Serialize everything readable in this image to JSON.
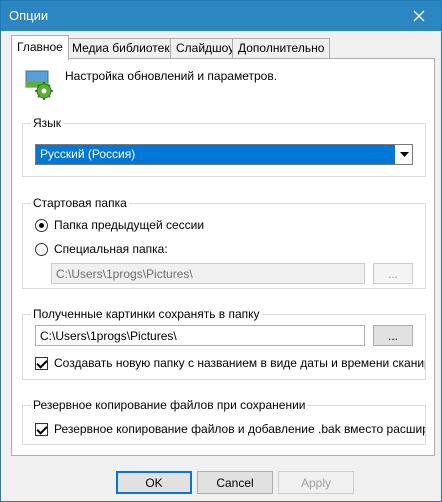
{
  "window": {
    "title": "Опции"
  },
  "tabs": [
    {
      "label": "Главное",
      "active": true
    },
    {
      "label": "Медиа библиотека",
      "active": false
    },
    {
      "label": "Слайдшоу",
      "active": false
    },
    {
      "label": "Дополнительно",
      "active": false
    }
  ],
  "header": {
    "icon": "settings-update-icon",
    "text": "Настройка обновлений и параметров."
  },
  "language": {
    "legend": "Язык",
    "selected": "Русский (Россия)"
  },
  "start_folder": {
    "legend": "Стартовая папка",
    "option_previous": "Папка предыдущей сессии",
    "option_special": "Специальная папка:",
    "special_path": "C:\\Users\\1progs\\Pictures\\",
    "browse_label": "...",
    "selected_option": "previous"
  },
  "save_folder": {
    "legend": "Полученные картинки сохранять в папку",
    "path": "C:\\Users\\1progs\\Pictures\\",
    "browse_label": "...",
    "subfolder_label": "Создавать новую папку с названием в виде даты и времени сканирования",
    "subfolder_checked": true
  },
  "backup": {
    "legend": "Резервное копирование файлов при сохранении",
    "checkbox_label": "Резервное копирование файлов и добавление .bak вместо расширения",
    "checked": true
  },
  "buttons": {
    "ok": "OK",
    "cancel": "Cancel",
    "apply": "Apply"
  },
  "colors": {
    "titlebar": "#2b86c2",
    "selection": "#0078d7"
  }
}
